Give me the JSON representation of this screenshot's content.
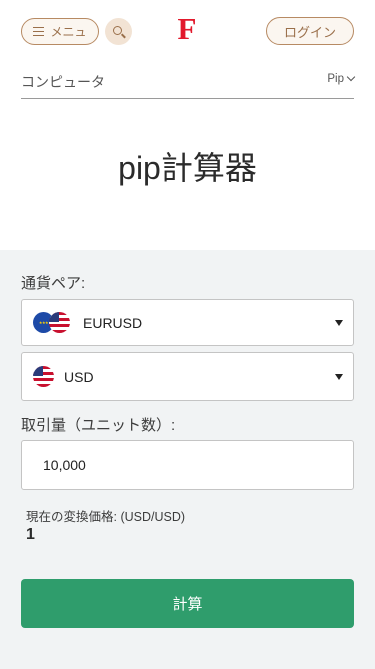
{
  "header": {
    "menu_label": "メニュ",
    "logo_text": "F",
    "login_label": "ログイン",
    "brand_color": "#e2192c",
    "accent_color": "#b78a63"
  },
  "subnav": {
    "breadcrumb": "コンピュータ",
    "dropdown_label": "Pip"
  },
  "page": {
    "title": "pip計算器"
  },
  "form": {
    "pair_label": "通貨ペア:",
    "pair_value": "EURUSD",
    "pair_flags": [
      "eu-flag-icon",
      "us-flag-icon"
    ],
    "account_currency_value": "USD",
    "units_label": "取引量（ユニット数）:",
    "units_value": "10,000",
    "rate_label": "現在の変換価格: (USD/USD)",
    "rate_value": "1",
    "calculate_label": "計算",
    "button_color": "#2f9d6c"
  }
}
